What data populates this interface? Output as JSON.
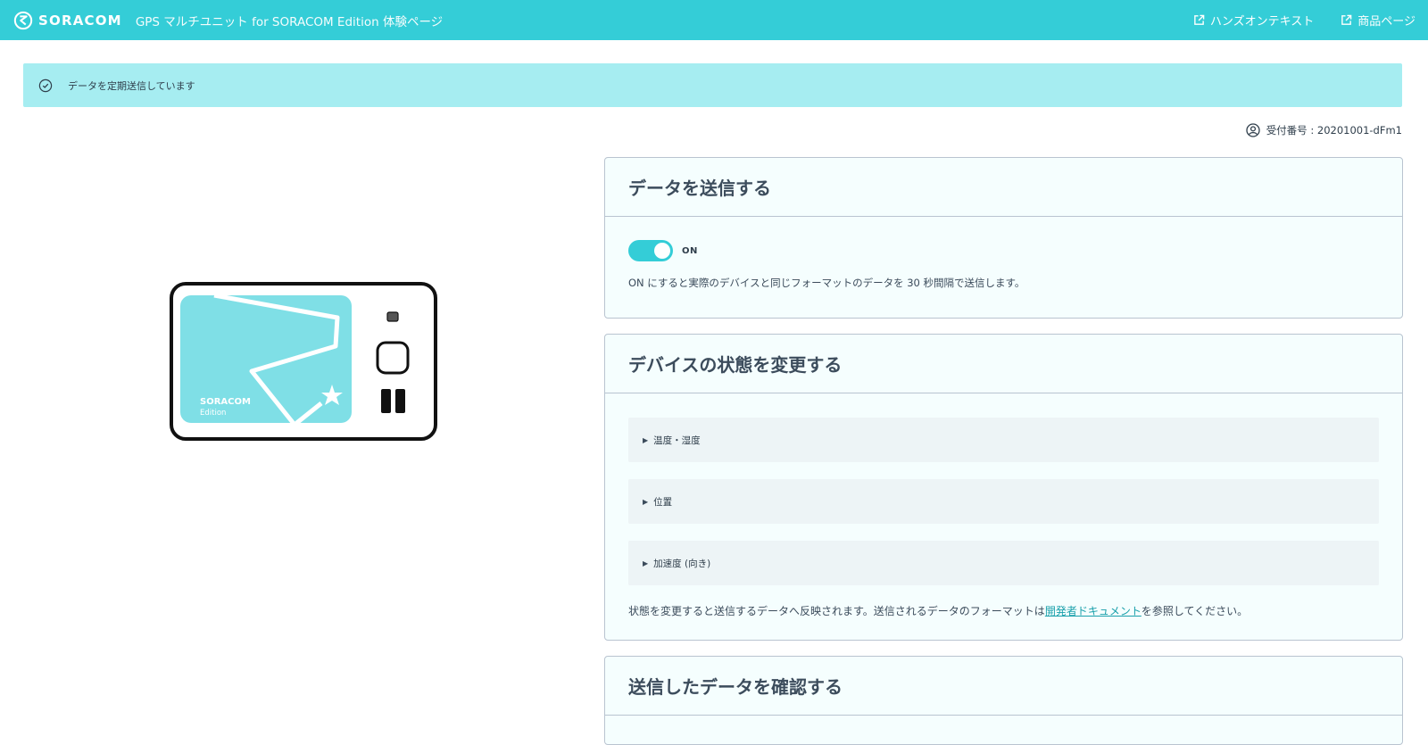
{
  "header": {
    "logo_text": "SORACOM",
    "title": "GPS マルチユニット for SORACOM Edition 体験ページ",
    "links": [
      {
        "label": "ハンズオンテキスト",
        "icon": "external-link-icon"
      },
      {
        "label": "商品ページ",
        "icon": "external-link-icon"
      }
    ]
  },
  "alert": {
    "icon": "check-circle-icon",
    "text": "データを定期送信しています"
  },
  "receipt": {
    "icon": "user-circle-icon",
    "label": "受付番号 : 20201001-dFm1"
  },
  "device": {
    "brand": "SORACOM",
    "edition": "Edition",
    "accent_color": "#7fdfe6"
  },
  "send_panel": {
    "title": "データを送信する",
    "toggle_state": "ON",
    "description": "ON にすると実際のデバイスと同じフォーマットのデータを 30 秒間隔で送信します。"
  },
  "state_panel": {
    "title": "デバイスの状態を変更する",
    "items": [
      {
        "label": "温度・湿度"
      },
      {
        "label": "位置"
      },
      {
        "label": "加速度 (向き)"
      }
    ],
    "desc_before": "状態を変更すると送信するデータへ反映されます。送信されるデータのフォーマットは",
    "desc_link": "開発者ドキュメント",
    "desc_after": "を参照してください。"
  },
  "confirm_panel": {
    "title": "送信したデータを確認する"
  },
  "colors": {
    "brand": "#34cdd7",
    "alert_bg": "#a6edf1",
    "link": "#1aa0ab"
  }
}
